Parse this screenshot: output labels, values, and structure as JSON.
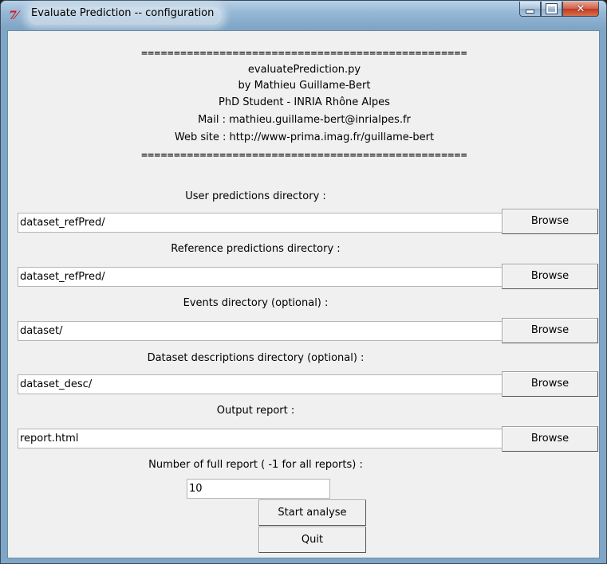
{
  "window": {
    "title": "Evaluate Prediction -- configuration",
    "icon": "tk-feather-icon",
    "controls": {
      "minimize": "minimize-icon",
      "maximize": "maximize-icon",
      "close": "close-icon"
    }
  },
  "header": {
    "separator_top": "==================================================",
    "line1": "evaluatePrediction.py",
    "line2": "by Mathieu Guillame-Bert",
    "line3": "PhD Student - INRIA Rhône Alpes",
    "line4": "Mail : mathieu.guillame-bert@inrialpes.fr",
    "line5": "Web site : http://www-prima.imag.fr/guillame-bert",
    "separator_bottom": "=================================================="
  },
  "fields": [
    {
      "label": "User predictions directory :",
      "value": "dataset_refPred/",
      "button": "Browse"
    },
    {
      "label": "Reference predictions directory :",
      "value": "dataset_refPred/",
      "button": "Browse"
    },
    {
      "label": "Events directory (optional) :",
      "value": "dataset/",
      "button": "Browse"
    },
    {
      "label": "Dataset descriptions directory (optional) :",
      "value": "dataset_desc/",
      "button": "Browse"
    },
    {
      "label": "Output report :",
      "value": "report.html",
      "button": "Browse"
    }
  ],
  "report_count": {
    "label": "Number of full report ( -1 for all reports) :",
    "value": "10"
  },
  "actions": {
    "start": "Start analyse",
    "quit": "Quit"
  },
  "colors": {
    "titlebar": "#93b6d4",
    "client_bg": "#f0f0f0",
    "close_button": "#c9472f"
  }
}
